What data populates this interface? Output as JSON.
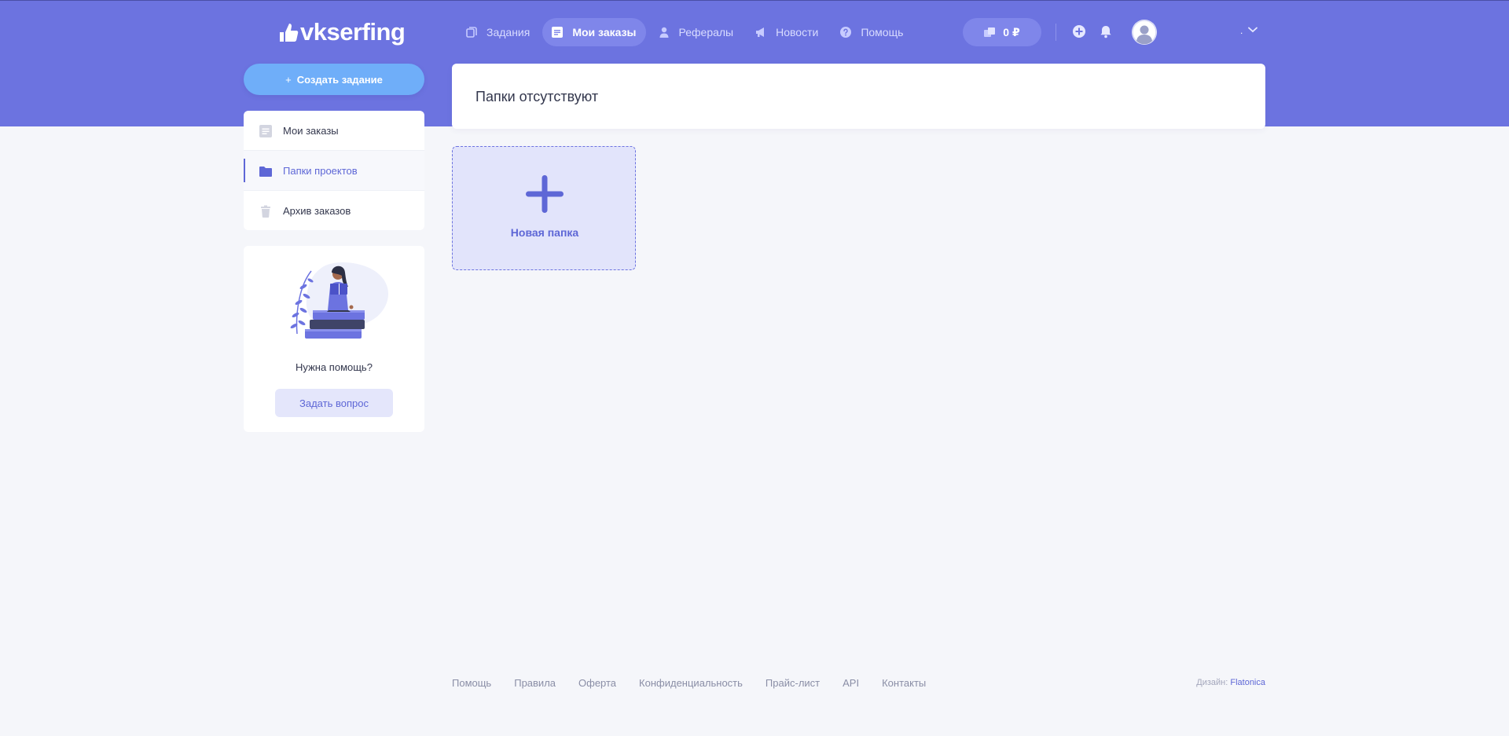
{
  "brand": {
    "logo_text": "vkserfing"
  },
  "nav": {
    "items": [
      {
        "label": "Задания",
        "icon": "copy-icon",
        "active": false
      },
      {
        "label": "Мои заказы",
        "icon": "document-icon",
        "active": true
      },
      {
        "label": "Рефералы",
        "icon": "user-icon",
        "active": false
      },
      {
        "label": "Новости",
        "icon": "megaphone-icon",
        "active": false
      },
      {
        "label": "Помощь",
        "icon": "question-icon",
        "active": false
      }
    ]
  },
  "header": {
    "balance": "0 ₽",
    "user_name": ".",
    "icons": [
      "add-circle-icon",
      "bell-icon",
      "avatar-icon",
      "chevron-down-icon"
    ]
  },
  "sidebar": {
    "create_button": {
      "plus": "+",
      "label": "Создать задание"
    },
    "menu": [
      {
        "label": "Мои заказы",
        "icon": "document-icon",
        "active": false
      },
      {
        "label": "Папки проектов",
        "icon": "folder-icon",
        "active": true
      },
      {
        "label": "Архив заказов",
        "icon": "trash-icon",
        "active": false
      }
    ],
    "help": {
      "title": "Нужна помощь?",
      "button": "Задать вопрос",
      "illustration": "reading-person-illustration"
    }
  },
  "main": {
    "empty_message": "Папки отсутствуют",
    "new_folder_label": "Новая папка"
  },
  "footer": {
    "links": [
      "Помощь",
      "Правила",
      "Оферта",
      "Конфиденциальность",
      "Прайс-лист",
      "API",
      "Контакты"
    ],
    "credit_prefix": "Дизайн:",
    "credit_link": "Flatonica"
  },
  "colors": {
    "header_bg": "#6c73e0",
    "accent": "#5e67d6",
    "create_button": "#6faef9",
    "page_bg": "#f5f6fa"
  }
}
